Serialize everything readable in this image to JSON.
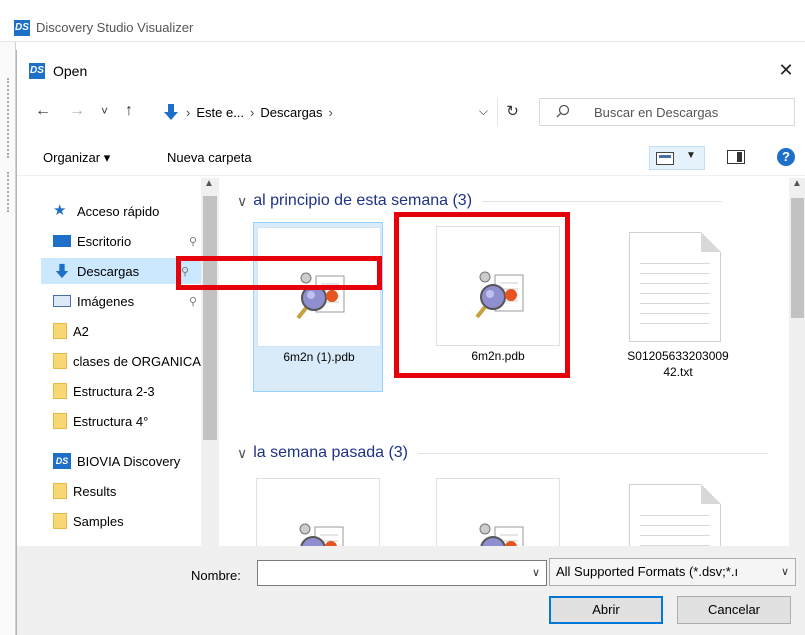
{
  "app": {
    "title": "Discovery Studio Visualizer",
    "logo": "DS"
  },
  "dialog": {
    "title": "Open",
    "logo": "DS",
    "close_glyph": "✕",
    "nav": {
      "back": "←",
      "forward": "→",
      "recent": "˅",
      "up": "↑"
    },
    "address": {
      "segments": [
        "Este e...",
        "Descargas"
      ],
      "sep": "›",
      "dropdown": "⌵"
    },
    "refresh": "↻",
    "search_placeholder": "Buscar en Descargas",
    "toolbar": {
      "organize": "Organizar ▾",
      "new_folder": "Nueva carpeta",
      "help": "?"
    },
    "sidebar": {
      "items": [
        {
          "label": "Acceso rápido",
          "icon": "star-icon",
          "pinned": false
        },
        {
          "label": "Escritorio",
          "icon": "desktop-icon",
          "pinned": true
        },
        {
          "label": "Descargas",
          "icon": "download-icon",
          "pinned": true,
          "selected": true
        },
        {
          "label": "Imágenes",
          "icon": "pictures-icon",
          "pinned": true
        },
        {
          "label": "A2",
          "icon": "folder-icon"
        },
        {
          "label": "clases de ORGANICA",
          "icon": "folder-icon"
        },
        {
          "label": "Estructura 2-3",
          "icon": "folder-icon"
        },
        {
          "label": "Estructura 4°",
          "icon": "folder-icon"
        },
        {
          "label": "BIOVIA Discovery",
          "icon": "ds-app-icon"
        },
        {
          "label": "Results",
          "icon": "folder-icon"
        },
        {
          "label": "Samples",
          "icon": "folder-icon"
        }
      ],
      "pin_glyph": "📌"
    },
    "groups": [
      {
        "label": "al principio de esta semana (3)",
        "files": [
          {
            "name": "6m2n (1).pdb",
            "kind": "pdb",
            "selected": true
          },
          {
            "name": "6m2n.pdb",
            "kind": "pdb",
            "selected": false
          },
          {
            "name": "S01205633203009\n42.txt",
            "kind": "txt",
            "selected": false
          }
        ]
      },
      {
        "label": "la semana pasada (3)",
        "files": [
          {
            "name": "",
            "kind": "pdb"
          },
          {
            "name": "",
            "kind": "pdb"
          },
          {
            "name": "",
            "kind": "txt"
          }
        ]
      }
    ],
    "bottom": {
      "filename_label": "Nombre:",
      "filename_value": "",
      "filetype": "All Supported Formats (*.dsv;*.ı",
      "open_button": "Abrir",
      "cancel_button": "Cancelar"
    },
    "colors": {
      "annotation": "#e5000a",
      "accent": "#0078d7",
      "selection": "#cce8ff"
    }
  }
}
